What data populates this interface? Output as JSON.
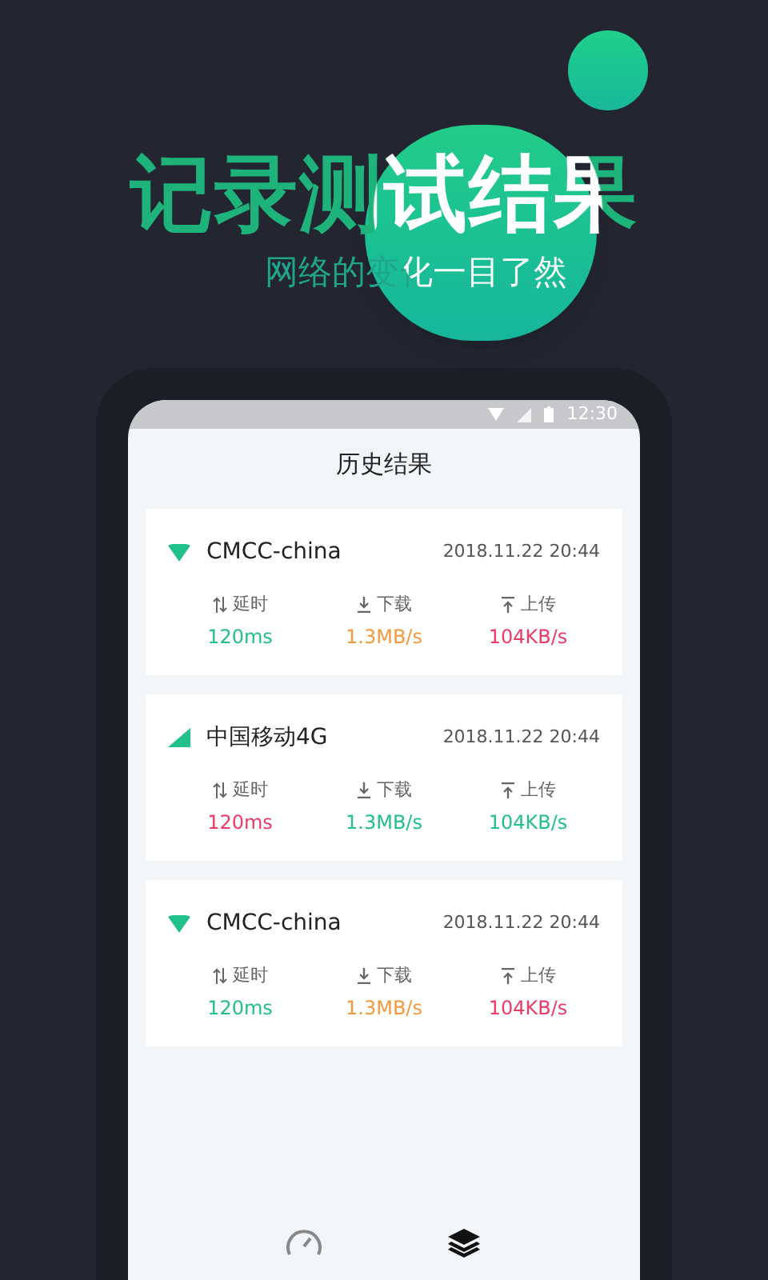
{
  "headline": "记录测试结果",
  "subtitle": "网络的变化一目了然",
  "status_bar": {
    "time": "12:30"
  },
  "screen_title": "历史结果",
  "records": [
    {
      "kind": "wifi",
      "network": "CMCC-china",
      "time": "2018.11.22 20:44",
      "metrics": [
        {
          "kind": "latency",
          "label": "延时",
          "value": "120ms",
          "color": "#22c08a"
        },
        {
          "kind": "download",
          "label": "下载",
          "value": "1.3MB/s",
          "color": "#f59a3c"
        },
        {
          "kind": "upload",
          "label": "上传",
          "value": "104KB/s",
          "color": "#ee3a64"
        }
      ]
    },
    {
      "kind": "cellular",
      "network": "中国移动4G",
      "time": "2018.11.22 20:44",
      "metrics": [
        {
          "kind": "latency",
          "label": "延时",
          "value": "120ms",
          "color": "#ee3a64"
        },
        {
          "kind": "download",
          "label": "下载",
          "value": "1.3MB/s",
          "color": "#22c08a"
        },
        {
          "kind": "upload",
          "label": "上传",
          "value": "104KB/s",
          "color": "#22c08a"
        }
      ]
    },
    {
      "kind": "wifi",
      "network": "CMCC-china",
      "time": "2018.11.22 20:44",
      "metrics": [
        {
          "kind": "latency",
          "label": "延时",
          "value": "120ms",
          "color": "#22c08a"
        },
        {
          "kind": "download",
          "label": "下载",
          "value": "1.3MB/s",
          "color": "#f59a3c"
        },
        {
          "kind": "upload",
          "label": "上传",
          "value": "104KB/s",
          "color": "#ee3a64"
        }
      ]
    }
  ],
  "bottom_nav": [
    {
      "kind": "speed",
      "selected": false
    },
    {
      "kind": "history",
      "selected": true
    }
  ]
}
